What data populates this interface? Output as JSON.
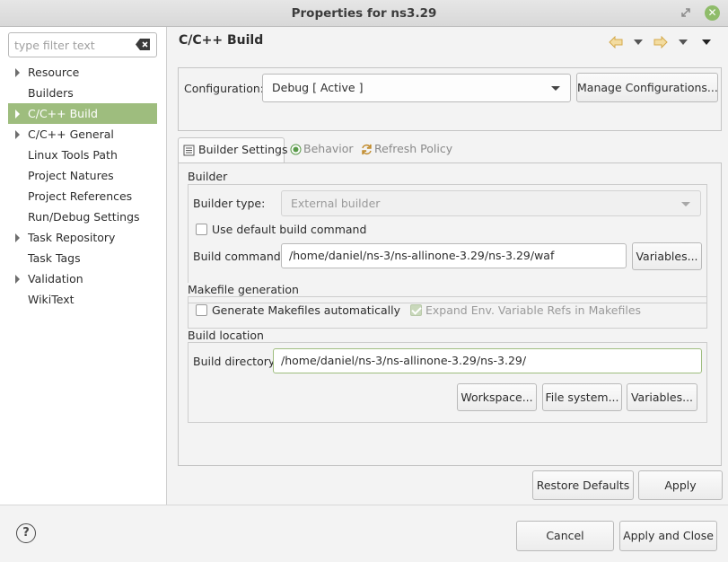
{
  "window": {
    "title": "Properties for ns3.29"
  },
  "sidebar": {
    "filter_placeholder": "type filter text",
    "items": [
      {
        "label": "Resource",
        "expandable": true
      },
      {
        "label": "Builders",
        "expandable": false
      },
      {
        "label": "C/C++ Build",
        "expandable": true,
        "selected": true
      },
      {
        "label": "C/C++ General",
        "expandable": true
      },
      {
        "label": "Linux Tools Path",
        "expandable": false
      },
      {
        "label": "Project Natures",
        "expandable": false
      },
      {
        "label": "Project References",
        "expandable": false
      },
      {
        "label": "Run/Debug Settings",
        "expandable": false
      },
      {
        "label": "Task Repository",
        "expandable": true
      },
      {
        "label": "Task Tags",
        "expandable": false
      },
      {
        "label": "Validation",
        "expandable": true
      },
      {
        "label": "WikiText",
        "expandable": false
      }
    ]
  },
  "main": {
    "title": "C/C++ Build",
    "configuration": {
      "label": "Configuration:",
      "value": "Debug  [ Active ]",
      "manage_button": "Manage Configurations..."
    },
    "tabs": [
      {
        "label": "Builder Settings",
        "icon": "builder-settings-icon",
        "active": true
      },
      {
        "label": "Behavior",
        "icon": "behavior-icon",
        "active": false
      },
      {
        "label": "Refresh Policy",
        "icon": "refresh-policy-icon",
        "active": false
      }
    ],
    "builder": {
      "group_title": "Builder",
      "type_label": "Builder type:",
      "type_value": "External builder",
      "use_default_label": "Use default build command",
      "command_label": "Build command:",
      "command_value": "/home/daniel/ns-3/ns-allinone-3.29/ns-3.29/waf",
      "variables_button": "Variables..."
    },
    "makefile": {
      "group_title": "Makefile generation",
      "generate_label": "Generate Makefiles automatically",
      "expand_label": "Expand Env. Variable Refs in Makefiles"
    },
    "location": {
      "group_title": "Build location",
      "dir_label": "Build directory:",
      "dir_value": "/home/daniel/ns-3/ns-allinone-3.29/ns-3.29/",
      "workspace_button": "Workspace...",
      "filesystem_button": "File system...",
      "variables_button": "Variables..."
    },
    "restore_button": "Restore Defaults",
    "apply_button": "Apply"
  },
  "footer": {
    "cancel_button": "Cancel",
    "apply_close_button": "Apply and Close"
  },
  "colors": {
    "selection": "#9ebd7e",
    "close_button": "#8fbc6a"
  }
}
